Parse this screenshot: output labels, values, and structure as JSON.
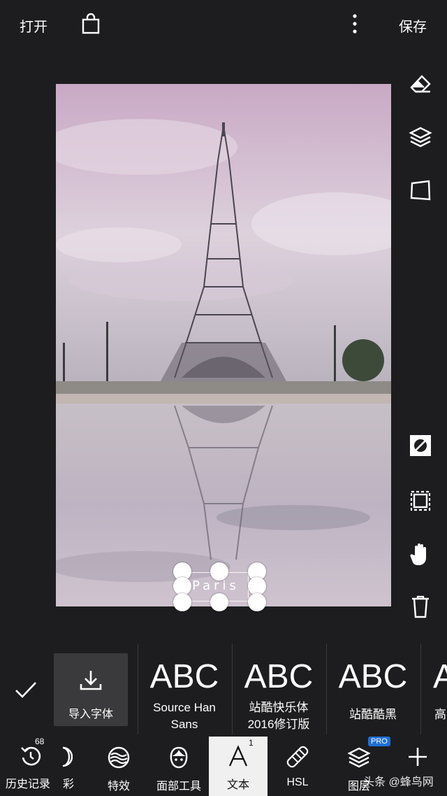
{
  "topbar": {
    "open_label": "打开",
    "save_label": "保存"
  },
  "canvas": {
    "text_overlay": "Paris"
  },
  "font_panel": {
    "import_label": "导入字体",
    "fonts": [
      {
        "preview": "ABC",
        "name": "Source Han\nSans"
      },
      {
        "preview": "ABC",
        "name": "站酷快乐体\n2016修订版"
      },
      {
        "preview": "ABC",
        "name": "站酷酷黑"
      },
      {
        "preview": "A",
        "name": "高"
      }
    ]
  },
  "toolbar": {
    "history_label": "历史记录",
    "history_count": "68",
    "color_label": "彩",
    "effects_label": "特效",
    "face_label": "面部工具",
    "text_label": "文本",
    "text_badge": "1",
    "hsl_label": "HSL",
    "layers_label": "图层",
    "pro_badge": "PRO"
  },
  "watermark": "头条 @蜂鸟网"
}
